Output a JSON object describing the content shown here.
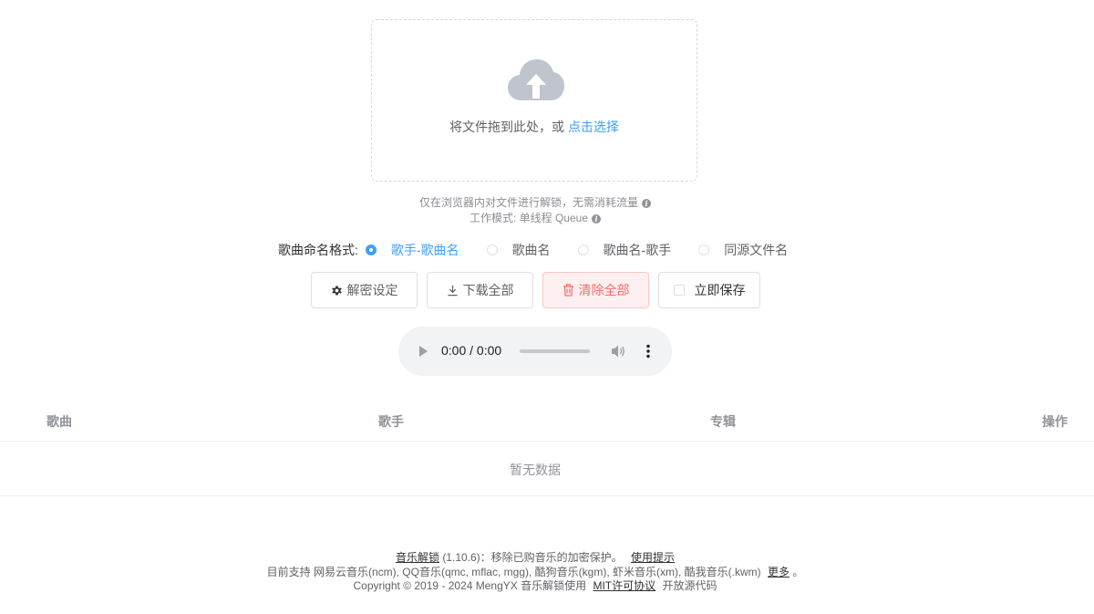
{
  "upload": {
    "text": "将文件拖到此处，或 ",
    "link": "点击选择",
    "icon": "cloud-upload-icon"
  },
  "tips": {
    "line1": "仅在浏览器内对文件进行解锁，无需消耗流量",
    "line2": "工作模式: 单线程 Queue"
  },
  "naming": {
    "label": "歌曲命名格式:",
    "options": [
      {
        "label": "歌手-歌曲名",
        "checked": true
      },
      {
        "label": "歌曲名",
        "checked": false
      },
      {
        "label": "歌曲名-歌手",
        "checked": false
      },
      {
        "label": "同源文件名",
        "checked": false
      }
    ]
  },
  "actions": {
    "settings": "解密设定",
    "download_all": "下载全部",
    "clear_all": "清除全部",
    "save_now": "立即保存"
  },
  "player": {
    "time": "0:00 / 0:00",
    "progress": 0
  },
  "table": {
    "columns": [
      "歌曲",
      "歌手",
      "专辑",
      "操作"
    ],
    "empty": "暂无数据"
  },
  "footer": {
    "app_name": "音乐解锁",
    "version": "(1.10.6)：移除已购音乐的加密保护。",
    "usage": "使用提示",
    "support_prefix": "目前支持 网易云音乐(ncm), QQ音乐(qmc, mflac, mgg), 酷狗音乐(kgm), 虾米音乐(xm), 酷我音乐(.kwm)",
    "more": "更多",
    "period": "。",
    "copyright": "Copyright © 2019 - 2024 MengYX 音乐解锁使用",
    "license": "MIT许可协议",
    "open_source": "开放源代码"
  },
  "colors": {
    "primary": "#409eff",
    "danger": "#f56c6c",
    "danger_bg": "#fef0f0"
  }
}
